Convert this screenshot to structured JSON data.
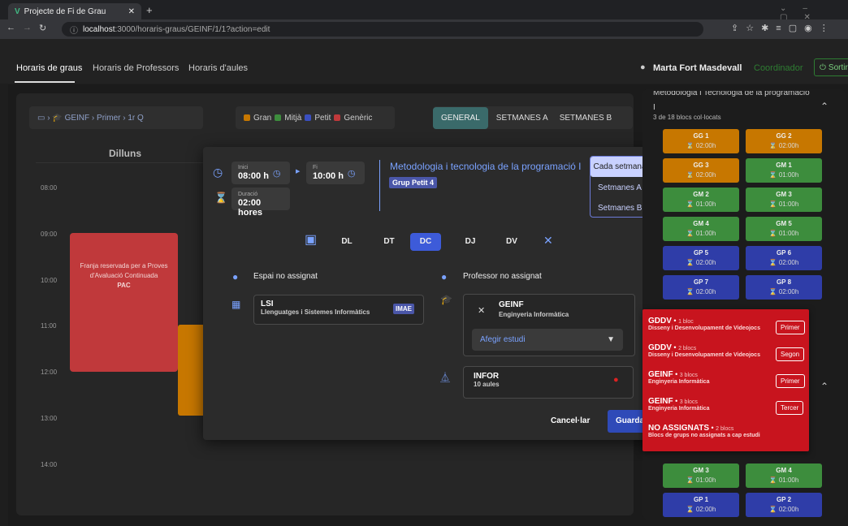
{
  "browser": {
    "tab_title": "Projecte de Fi de Grau",
    "url_host": "localhost",
    "url_path": ":3000/horaris-graus/GEINF/1/1?action=edit"
  },
  "nav": {
    "items": [
      "Horaris de graus",
      "Horaris de Professors",
      "Horaris d'aules"
    ],
    "user": "Marta Fort Masdevall",
    "role": "Coordinador",
    "logout": "Sortir"
  },
  "breadcrumb": {
    "grade": "GEINF",
    "course": "Primer",
    "quarter": "1r Q"
  },
  "legend": [
    "Gran",
    "Mitjà",
    "Petit",
    "Genèric"
  ],
  "view_tabs": [
    "GENERAL",
    "SETMANES A",
    "SETMANES B"
  ],
  "calendar": {
    "day": "Dilluns",
    "hours": [
      "08:00",
      "09:00",
      "10:00",
      "11:00",
      "12:00",
      "13:00",
      "14:00"
    ],
    "pac": {
      "line1": "Franja reservada per a Proves",
      "line2": "d'Avaluació Continuada",
      "label": "PAC"
    }
  },
  "dialog": {
    "start_label": "Inici",
    "start": "08:00 h",
    "end_label": "Fi",
    "end": "10:00 h",
    "duration_label": "Duració",
    "duration": "02:00 hores",
    "subject": "Metodologia i tecnologia de la programació I",
    "group": "Grup Petit 4",
    "weeks": [
      "Cada setmana",
      "Setmanes A",
      "Setmanes B"
    ],
    "days": [
      "DL",
      "DT",
      "DC",
      "DJ",
      "DV"
    ],
    "space": "Espai no assignat",
    "teacher": "Professor no assignat",
    "room_code": "LSI",
    "room_name": "Llenguatges i Sistemes Informàtics",
    "room_badge": "IMAE",
    "study_code": "GEINF",
    "study_name": "Enginyeria Informàtica",
    "add_study": "Afegir estudi",
    "lab_code": "INFOR",
    "lab_count": "10 aules",
    "cancel": "Cancel·lar",
    "save": "Guarda"
  },
  "right": {
    "title": "Metodologia i Tecnologia de la programació",
    "title2": "I",
    "subtitle": "3 de 18 blocs col·locats",
    "blocks": [
      [
        "GG 1",
        "02:00h",
        "orange"
      ],
      [
        "GG 2",
        "02:00h",
        "orange"
      ],
      [
        "GG 3",
        "02:00h",
        "orange"
      ],
      [
        "GM 1",
        "01:00h",
        "green"
      ],
      [
        "GM 2",
        "01:00h",
        "green"
      ],
      [
        "GM 3",
        "01:00h",
        "green"
      ],
      [
        "GM 4",
        "01:00h",
        "green"
      ],
      [
        "GM 5",
        "01:00h",
        "green"
      ],
      [
        "GP 5",
        "02:00h",
        "blue"
      ],
      [
        "GP 6",
        "02:00h",
        "blue"
      ],
      [
        "GP 7",
        "02:00h",
        "blue"
      ],
      [
        "GP 8",
        "02:00h",
        "blue"
      ]
    ],
    "bottom_blocks": [
      [
        "GM 3",
        "01:00h",
        "green"
      ],
      [
        "GM 4",
        "01:00h",
        "green"
      ],
      [
        "GP 1",
        "02:00h",
        "blue"
      ],
      [
        "GP 2",
        "02:00h",
        "blue"
      ]
    ]
  },
  "popup": [
    {
      "code": "GDDV",
      "count": "1 bloc",
      "name": "Disseny i Desenvolupament de Videojocs",
      "btn": "Primer"
    },
    {
      "code": "GDDV",
      "count": "2 blocs",
      "name": "Disseny i Desenvolupament de Videojocs",
      "btn": "Segon"
    },
    {
      "code": "GEINF",
      "count": "3 blocs",
      "name": "Enginyeria Informàtica",
      "btn": "Primer"
    },
    {
      "code": "GEINF",
      "count": "3 blocs",
      "name": "Enginyeria Informàtica",
      "btn": "Tercer"
    },
    {
      "code": "NO ASSIGNATS",
      "count": "2 blocs",
      "name": "Blocs de grups no assignats a cap estudi",
      "btn": ""
    }
  ]
}
